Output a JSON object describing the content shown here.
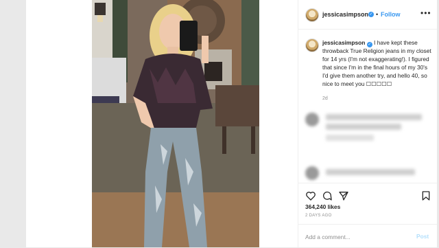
{
  "post": {
    "username": "jessicasimpson",
    "verified_icon": "verified-badge-icon",
    "dot": "•",
    "follow_label": "Follow",
    "more_icon": "more-options-icon",
    "caption_user": "jessicasimpson",
    "caption_body": "I have kept these throwback True Religion jeans in my closet for 14 yrs (I'm not exaggerating!). I figured that since I'm in the final hours of my 30's I'd give them another try, and hello 40, so nice to meet you",
    "caption_emoji": "☐☐☐☐☐",
    "caption_time": "2d",
    "likes": "364,240 likes",
    "date": "2 DAYS AGO",
    "comment_placeholder": "Add a comment...",
    "post_label": "Post"
  },
  "icons": {
    "like": "heart-icon",
    "comment": "comment-icon",
    "share": "share-icon",
    "save": "bookmark-icon"
  },
  "colors": {
    "accent": "#3897f0",
    "post_disabled": "#b2dffc",
    "muted": "#8e8e8e"
  }
}
